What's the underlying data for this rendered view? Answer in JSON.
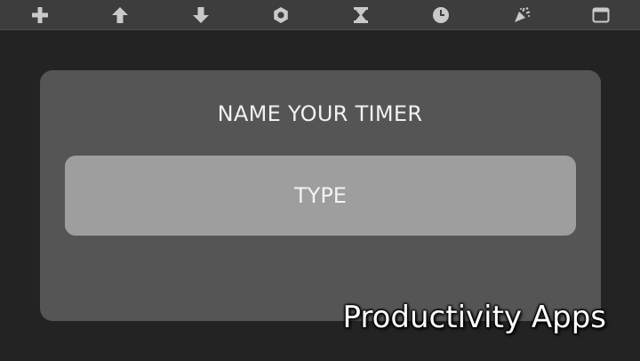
{
  "toolbar": {
    "buttons": [
      {
        "icon": "plus-icon"
      },
      {
        "icon": "arrow-up-icon"
      },
      {
        "icon": "arrow-down-icon"
      },
      {
        "icon": "gear-icon"
      },
      {
        "icon": "hourglass-icon"
      },
      {
        "icon": "clock-icon"
      },
      {
        "icon": "party-popper-icon"
      },
      {
        "icon": "window-icon"
      }
    ],
    "icon_color": "#c9c9c9"
  },
  "dialog": {
    "title": "NAME YOUR TIMER",
    "input": {
      "placeholder": "TYPE",
      "value": ""
    }
  },
  "watermark": "Productivity Apps",
  "colors": {
    "background": "#232323",
    "toolbar": "#3d3d3d",
    "dialog": "#555555",
    "input": "#9e9e9e",
    "text": "#f1f1f1"
  }
}
